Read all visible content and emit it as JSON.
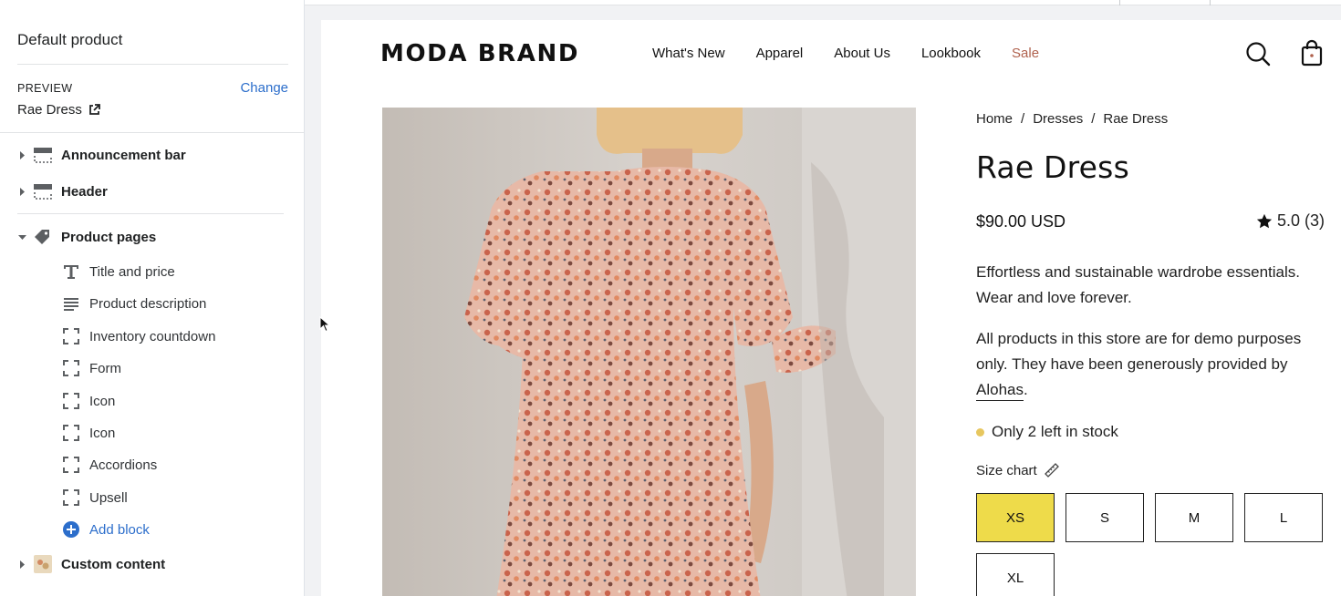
{
  "sidebar": {
    "template_name": "Default product",
    "preview_label": "PREVIEW",
    "change_label": "Change",
    "preview_product": "Rae Dress",
    "sections": [
      {
        "label": "Announcement bar",
        "icon": "layout-section-icon"
      },
      {
        "label": "Header",
        "icon": "layout-header-icon"
      },
      {
        "label": "Product pages",
        "icon": "tag-icon"
      },
      {
        "label": "Custom content",
        "icon": "image-thumbnail-icon"
      }
    ],
    "blocks": [
      {
        "label": "Title and price",
        "icon": "text-icon"
      },
      {
        "label": "Product description",
        "icon": "paragraph-icon"
      },
      {
        "label": "Inventory countdown",
        "icon": "block-placeholder-icon"
      },
      {
        "label": "Form",
        "icon": "block-placeholder-icon"
      },
      {
        "label": "Icon",
        "icon": "block-placeholder-icon"
      },
      {
        "label": "Icon",
        "icon": "block-placeholder-icon"
      },
      {
        "label": "Accordions",
        "icon": "block-placeholder-icon"
      },
      {
        "label": "Upsell",
        "icon": "block-placeholder-icon"
      }
    ],
    "add_block_label": "Add block"
  },
  "store": {
    "brand": "MODA BRAND",
    "nav": [
      "What's New",
      "Apparel",
      "About Us",
      "Lookbook",
      "Sale"
    ],
    "breadcrumb": [
      "Home",
      "/",
      "Dresses",
      "/",
      "Rae Dress"
    ],
    "product_title": "Rae Dress",
    "price": "$90.00 USD",
    "rating": "5.0 (3)",
    "description_1": "Effortless and sustainable wardrobe essentials. Wear and love forever.",
    "description_2_prefix": "All products in this store are for demo purposes only. They have been generously provided by ",
    "description_2_link": "Alohas",
    "description_2_suffix": ".",
    "stock_text": "Only 2 left in stock",
    "size_chart_label": "Size chart",
    "sizes": [
      "XS",
      "S",
      "M",
      "L",
      "XL"
    ],
    "selected_size": "XS"
  },
  "colors": {
    "accent_link": "#2c6ecb",
    "sale": "#b0624e",
    "selected_size_bg": "#eedb4a",
    "stock_dot": "#e7c75f"
  }
}
